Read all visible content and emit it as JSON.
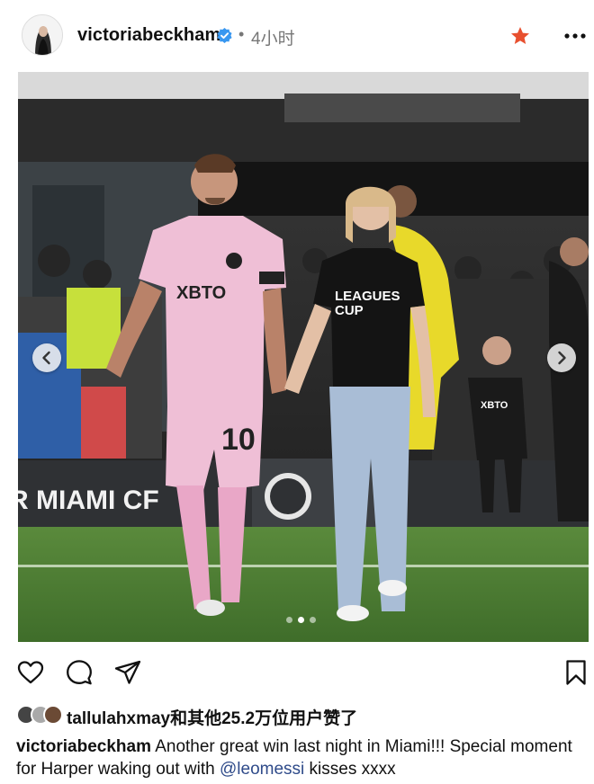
{
  "post": {
    "username": "victoriabeckham",
    "time_separator": "•",
    "time_ago": "4小时"
  },
  "icons": {
    "verified": "verified-badge-icon",
    "favorite": "star-icon",
    "more": "more-options-icon",
    "like": "heart-icon",
    "comment": "comment-bubble-icon",
    "share": "paper-plane-icon",
    "save": "bookmark-icon",
    "prev": "chevron-left-icon",
    "next": "chevron-right-icon"
  },
  "photo": {
    "shirt_text": "XBTO",
    "number": "10",
    "tee_text_line1": "LEAGUES",
    "tee_text_line2": "CUP",
    "banner_text": "R MIAMI CF",
    "pager": {
      "count": 3,
      "active_index": 1
    }
  },
  "likes": {
    "user": "tallulahxmay",
    "suffix": "和其他25.2万位用户赞了"
  },
  "caption": {
    "username": "victoriabeckham",
    "text": " Another great win last night in Miami!!! Special moment for Harper waking out with ",
    "mention": "@leomessi",
    "tail": " kisses xxxx"
  },
  "colors": {
    "accent_star": "#e8502f",
    "verified_blue": "#3897f0",
    "mention": "#2f4b8a",
    "jersey_pink": "#efbfd6"
  }
}
